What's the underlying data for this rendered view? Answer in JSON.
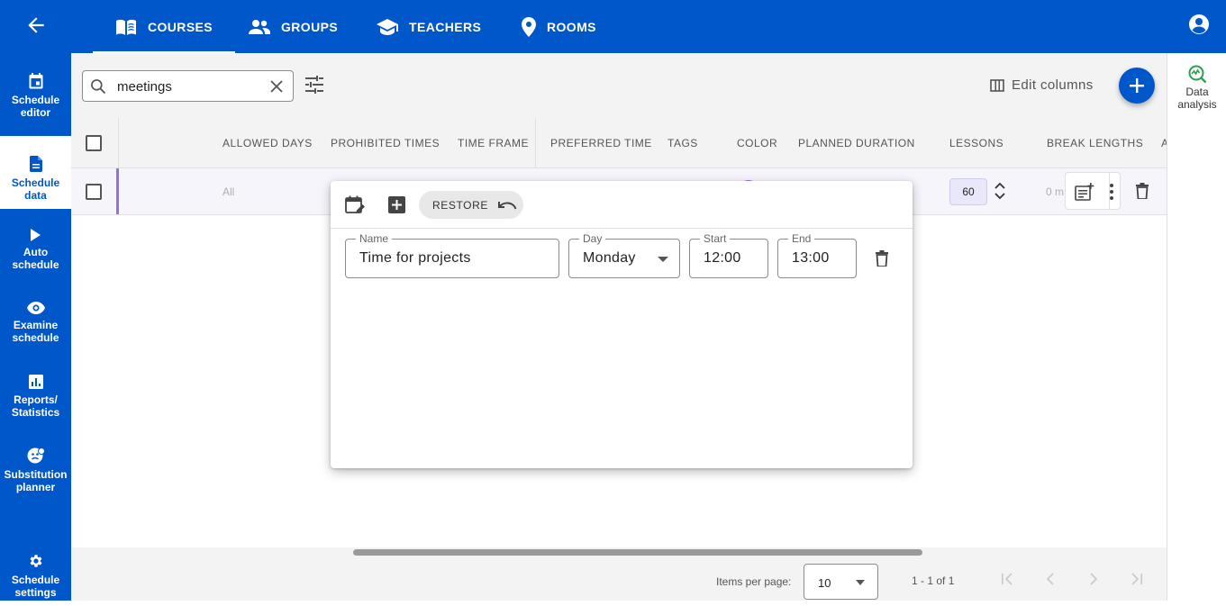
{
  "topbar": {
    "tabs": [
      {
        "label": "COURSES",
        "icon": "book-open-icon",
        "active": true
      },
      {
        "label": "GROUPS",
        "icon": "people-icon",
        "active": false
      },
      {
        "label": "TEACHERS",
        "icon": "school-icon",
        "active": false
      },
      {
        "label": "ROOMS",
        "icon": "map-pin-icon",
        "active": false
      }
    ]
  },
  "sidebar": {
    "items": [
      {
        "label": "Schedule editor",
        "icon": "calendar-icon"
      },
      {
        "label": "Schedule data",
        "icon": "document-icon",
        "active": true
      },
      {
        "label": "Auto schedule",
        "icon": "play-icon"
      },
      {
        "label": "Examine schedule",
        "icon": "eye-icon"
      },
      {
        "label": "Reports/ Statistics",
        "icon": "bar-chart-icon"
      },
      {
        "label": "Substitution planner",
        "icon": "substitution-icon"
      },
      {
        "label": "Schedule settings",
        "icon": "gear-icon"
      }
    ]
  },
  "toolbar": {
    "search_value": "meetings",
    "edit_columns_label": "Edit columns"
  },
  "table": {
    "columns": [
      "ALLOWED DAYS",
      "PROHIBITED TIMES",
      "TIME FRAME",
      "PREFERRED TIME",
      "TAGS",
      "COLOR",
      "PLANNED DURATION",
      "LESSONS",
      "BREAK LENGTHS",
      "A"
    ],
    "row": {
      "allowed_days": "All",
      "lessons": "60",
      "break_lengths": "0 m"
    }
  },
  "popup": {
    "restore_label": "RESTORE",
    "name_label": "Name",
    "name_value": "Time for projects",
    "day_label": "Day",
    "day_value": "Monday",
    "start_label": "Start",
    "start_value": "12:00",
    "end_label": "End",
    "end_value": "13:00"
  },
  "footer": {
    "items_per_page_label": "Items per page:",
    "items_per_page_value": "10",
    "range_text": "1 - 1 of 1"
  },
  "right_panel": {
    "data_analysis_label": "Data analysis"
  },
  "colors": {
    "brand": "#0057c9",
    "row_accent": "#9b6ede",
    "analysis_icon": "#2e9e4f"
  }
}
